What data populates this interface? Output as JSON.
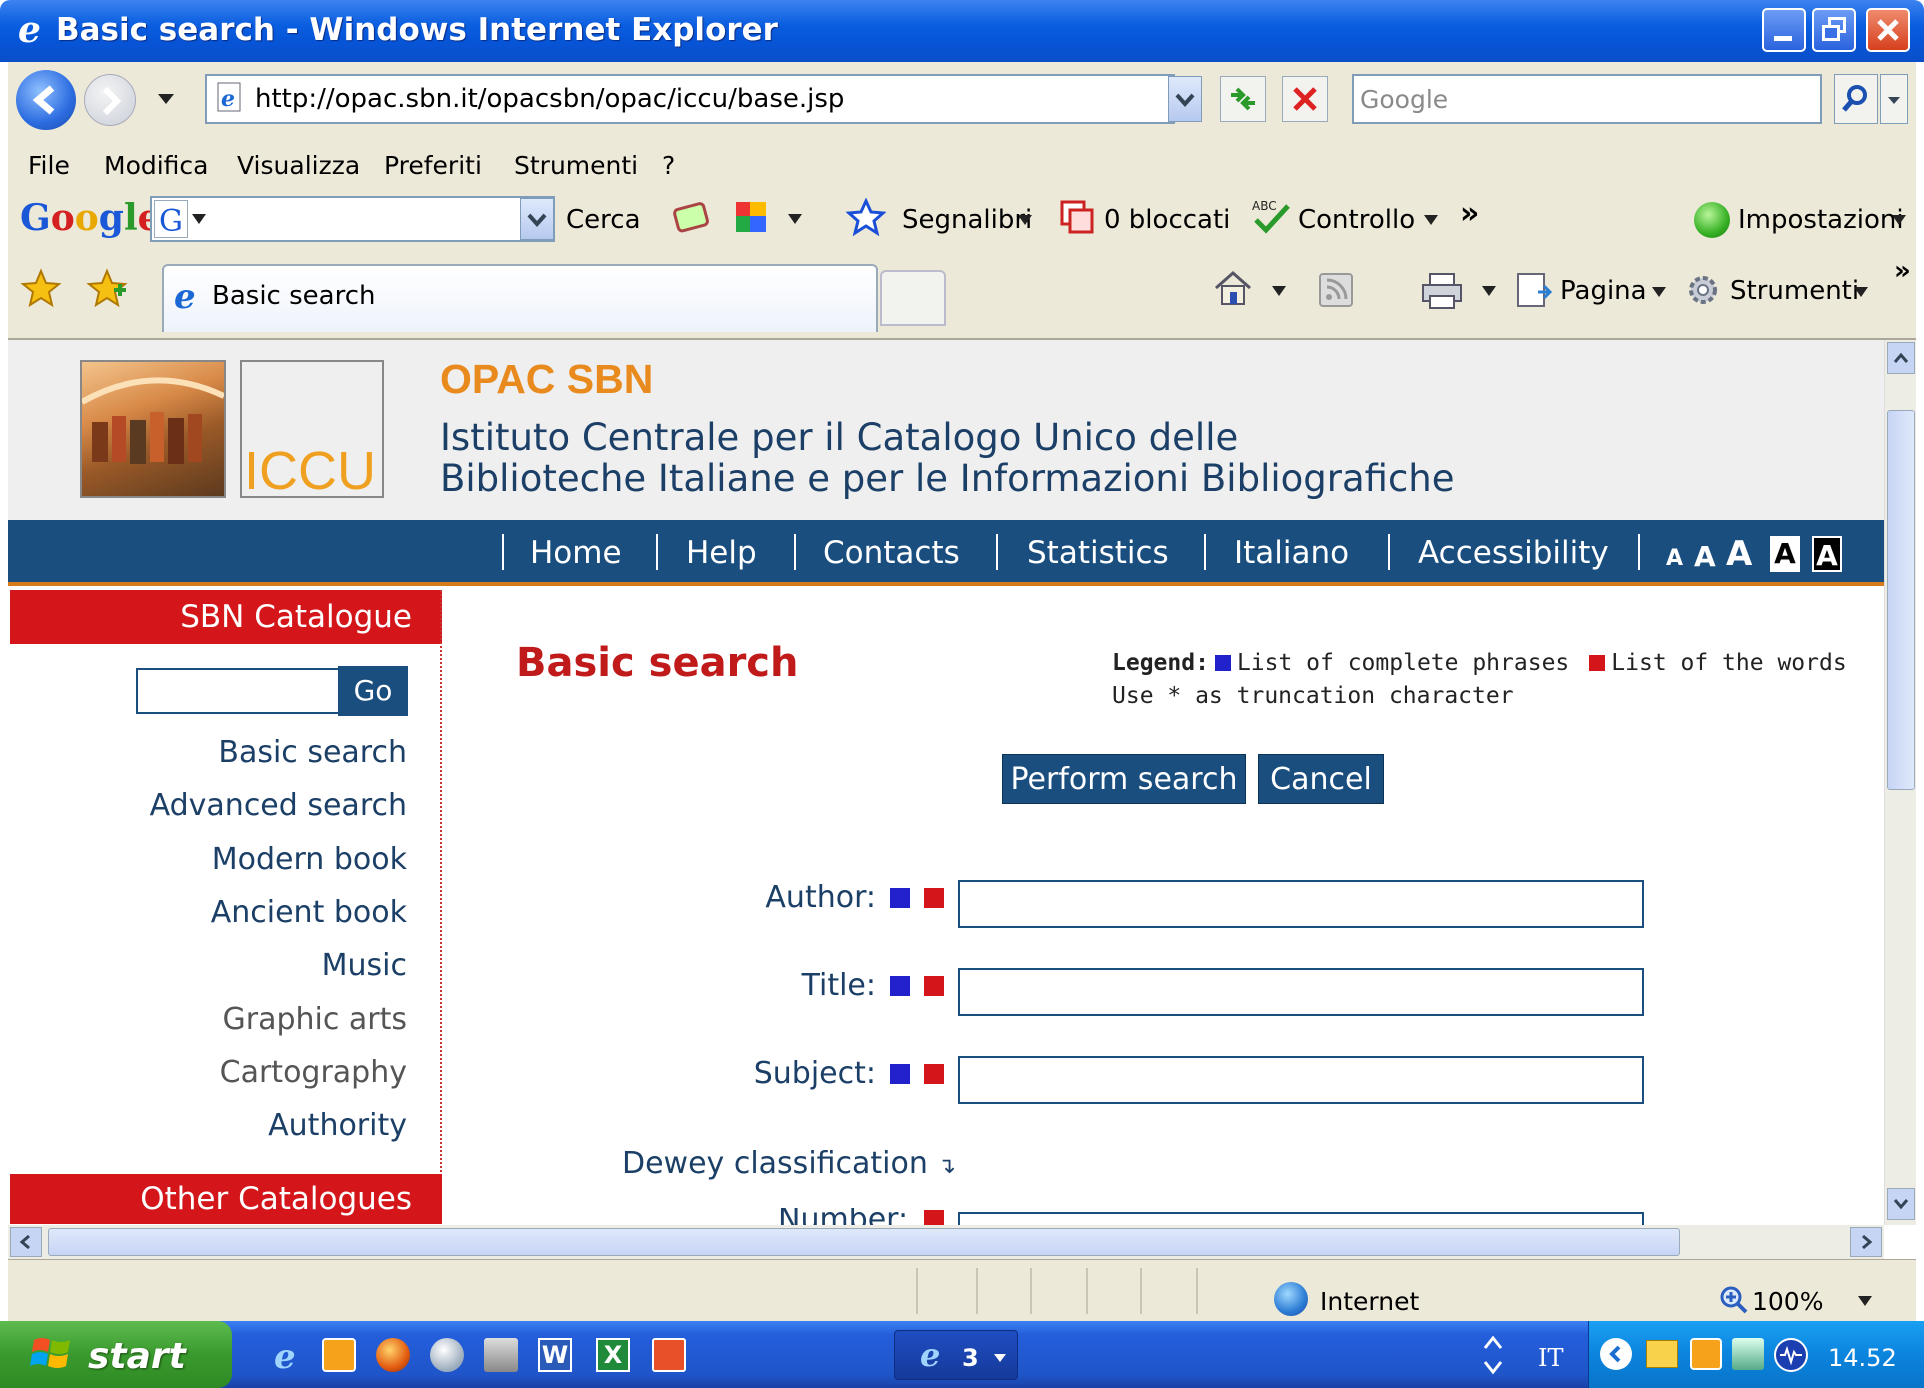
{
  "window": {
    "title": "Basic search - Windows Internet Explorer"
  },
  "address": {
    "url": "http://opac.sbn.it/opacsbn/opac/iccu/base.jsp",
    "search_placeholder": "Google"
  },
  "menu": {
    "items": [
      "File",
      "Modifica",
      "Visualizza",
      "Preferiti",
      "Strumenti",
      "?"
    ]
  },
  "google_toolbar": {
    "logo": "Google",
    "search_label": "Cerca",
    "bookmarks_label": "Segnalibri",
    "blocked_label": "0 bloccati",
    "check_label": "Controllo",
    "more_label": "»",
    "settings_label": "Impostazioni"
  },
  "tabs": {
    "active_title": "Basic search"
  },
  "command_bar": {
    "page_label": "Pagina",
    "tools_label": "Strumenti",
    "more_label": "»"
  },
  "site": {
    "logo_text": "ICCU",
    "title": "OPAC SBN",
    "subtitle_line1": "Istituto Centrale per il Catalogo Unico delle",
    "subtitle_line2": "Biblioteche  Italiane e per le Informazioni Bibliografiche"
  },
  "nav": {
    "links": [
      "Home",
      "Help",
      "Contacts",
      "Statistics",
      "Italiano",
      "Accessibility"
    ],
    "font_sizes": [
      "A",
      "A",
      "A",
      "A",
      "A"
    ]
  },
  "sidebar": {
    "catalogue_heading": "SBN Catalogue",
    "go_label": "Go",
    "links": [
      "Basic search",
      "Advanced search",
      "Modern book",
      "Ancient book",
      "Music",
      "Graphic arts",
      "Cartography",
      "Authority"
    ],
    "other_heading": "Other Catalogues"
  },
  "main": {
    "heading": "Basic search",
    "legend_label": "Legend:",
    "legend_phrases": "List of complete phrases",
    "legend_words": "List of the words",
    "truncation_hint": "Use * as truncation character",
    "perform_label": "Perform search",
    "cancel_label": "Cancel",
    "fields": [
      "Author:",
      "Title:",
      "Subject:"
    ],
    "dewey_label": "Dewey classification",
    "number_label": "Number:"
  },
  "status": {
    "zone": "Internet",
    "zoom": "100%"
  },
  "taskbar": {
    "start_label": "start",
    "ie_group_count": "3",
    "lang": "IT",
    "clock": "14.52"
  },
  "colors": {
    "navbar": "#1a4e7f",
    "accent_orange": "#e98a1f",
    "sidebar_red": "#d4161a",
    "heading_red": "#c01a1a",
    "legend_blue": "#2222cc"
  }
}
